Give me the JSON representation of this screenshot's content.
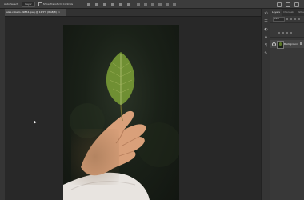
{
  "options_bar": {
    "auto_select_label": "Auto-Select:",
    "auto_select_value": "Layer",
    "transform_controls_label": "Show Transform Controls"
  },
  "document": {
    "tab_title": "alex-rebello-39854.jpeg @ 12.5% (RGB/8)",
    "close_glyph": "×"
  },
  "panels": {
    "tabs": [
      "Layers",
      "Channels",
      "Paths"
    ],
    "active_tab": "Layers",
    "kind_filter": "Kind",
    "layers": [
      {
        "name": "Background",
        "visible": true,
        "locked": true
      }
    ]
  },
  "colors": {
    "brand_blue": "#1b88d6",
    "brand_orange": "#f0a010",
    "leaf": "#6f8f33"
  }
}
